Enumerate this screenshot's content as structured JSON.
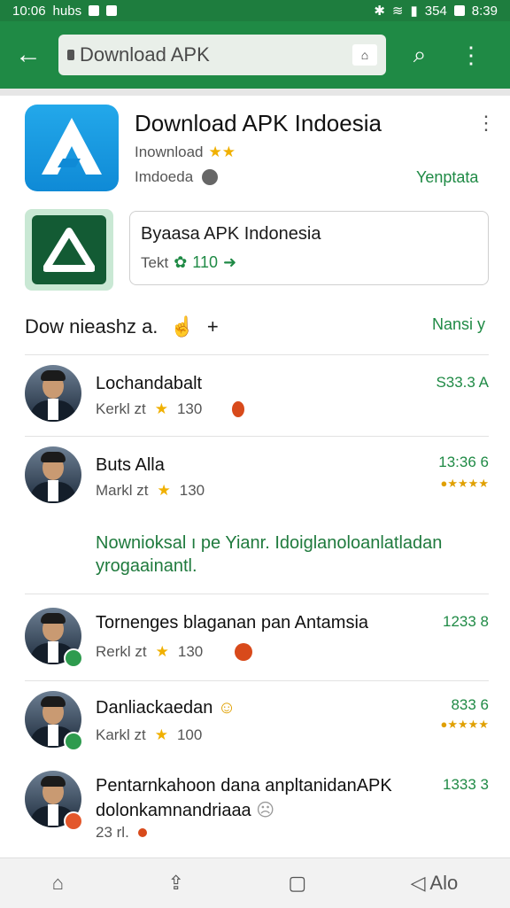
{
  "statusbar": {
    "time_left": "10:06",
    "label": "hubs",
    "signal": "354",
    "time_right": "8:39"
  },
  "toolbar": {
    "search_text": "Download APK"
  },
  "header": {
    "title": "Download APK Indoesia",
    "subtitle1": "Inownload",
    "subtitle2": "Imdoeda",
    "more": "⋮",
    "link": "Yenptata"
  },
  "card": {
    "title": "Byaasa APK Indonesia",
    "meta_label": "Tekt",
    "meta_value": "110"
  },
  "section": {
    "title": "Dow nieashz a.",
    "link": "Nansi y"
  },
  "rows": [
    {
      "name": "Lochandabalt",
      "meta": "Kerkl zt",
      "rating": "130",
      "value": "S33.3 A"
    },
    {
      "name": "Buts Alla",
      "meta": "Markl zt",
      "rating": "130",
      "value": "13:36 6"
    },
    {
      "name": "Tornenges blaganan pan Antamsia",
      "meta": "Rerkl zt",
      "rating": "130",
      "value": "1233 8"
    },
    {
      "name": "Danliackaedan",
      "meta": "Karkl zt",
      "rating": "100",
      "value": "833 6"
    },
    {
      "name": "Pentarnkahoon dana anpltanidanAPK",
      "name2": "dolonkamnandriaaa",
      "meta": "23 rl.",
      "value": "1333 3"
    }
  ],
  "promo": "Nownioksal ı pe  Yianr. Idoiglanoloanlatladan yrogaainantl."
}
